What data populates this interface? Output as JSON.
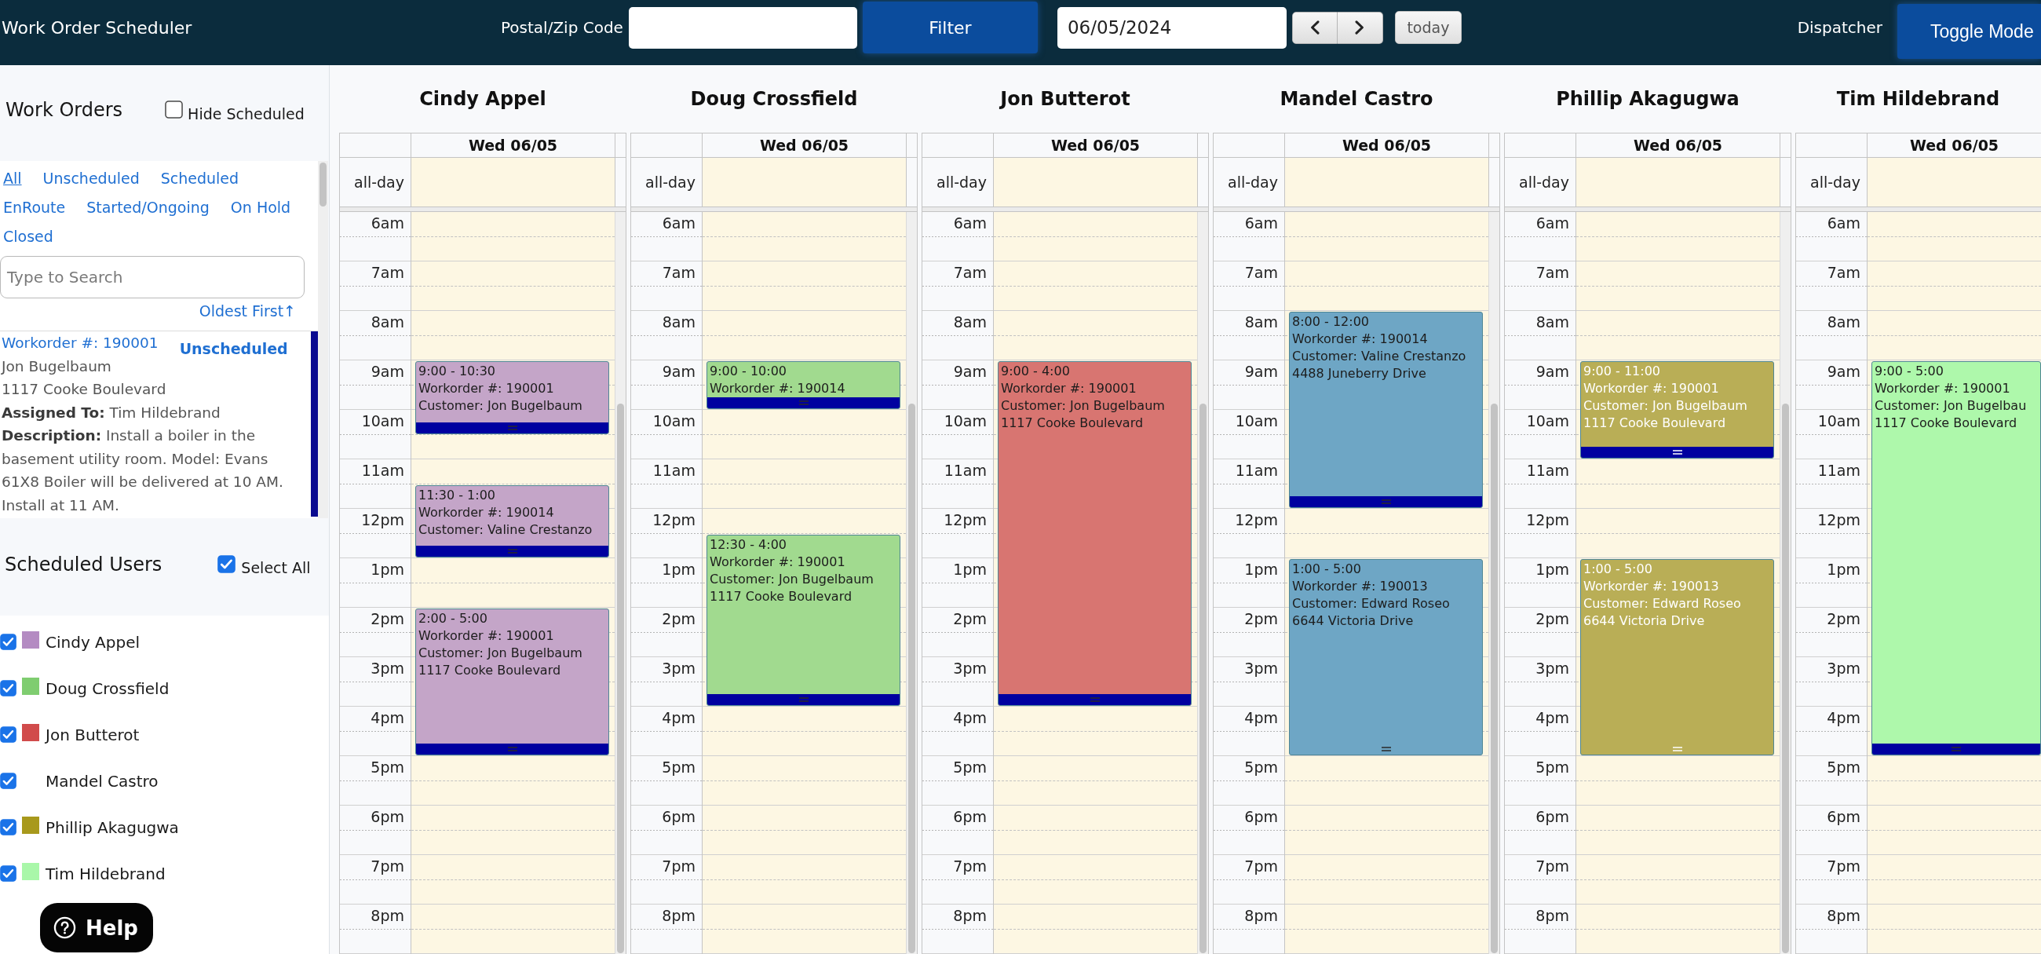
{
  "header": {
    "title": "Work Order Scheduler",
    "postal_label": "Postal/Zip Code",
    "filter_button": "Filter",
    "date": "06/05/2024",
    "today_button": "today",
    "mode_label": "Dispatcher",
    "toggle_button": "Toggle Mode"
  },
  "sidebar": {
    "work_orders": {
      "title": "Work Orders",
      "hide_scheduled": {
        "label": "Hide Scheduled",
        "checked": false
      },
      "filters": [
        {
          "label": "All",
          "selected": true
        },
        {
          "label": "Unscheduled",
          "selected": false
        },
        {
          "label": "Scheduled",
          "selected": false
        },
        {
          "label": "EnRoute",
          "selected": false
        },
        {
          "label": "Started/Ongoing",
          "selected": false
        },
        {
          "label": "On Hold",
          "selected": false
        },
        {
          "label": "Closed",
          "selected": false
        }
      ],
      "search": {
        "placeholder": "Type to Search"
      },
      "sort": "Oldest First↑",
      "items": [
        {
          "number": "Workorder #: 190001",
          "status": "Unscheduled",
          "customer": "Jon Bugelbaum",
          "address": "1117 Cooke Boulevard",
          "assigned": "**Assigned To:** Tim Hildebrand",
          "description": "**Description:** Install a boiler in the basement utility room. Model: Evans 61X8 Boiler will be delivered at 10 AM. Install at 11 AM."
        }
      ]
    },
    "scheduled_users": {
      "title": "Scheduled Users",
      "select_all": {
        "label": "Select All",
        "checked": true
      },
      "users": [
        {
          "name": "Cindy Appel",
          "checked": true,
          "color": "#b48bc2"
        },
        {
          "name": "Doug Crossfield",
          "checked": true,
          "color": "#7fcd70"
        },
        {
          "name": "Jon Butterot",
          "checked": true,
          "color": "#d14b4b"
        },
        {
          "name": "Mandel Castro",
          "checked": true
        },
        {
          "name": "Phillip Akagugwa",
          "checked": true,
          "color": "#a8991c"
        },
        {
          "name": "Tim Hildebrand",
          "checked": true,
          "color": "#a9f7a9"
        }
      ]
    },
    "help_button": "Help"
  },
  "calendar": {
    "columns": [
      {
        "name": "Cindy Appel",
        "day": "Wed 06/05",
        "all_day": "all-day",
        "hours": [
          "6am",
          "7am",
          "8am",
          "9am",
          "10am",
          "11am",
          "12pm",
          "1pm",
          "2pm",
          "3pm",
          "4pm",
          "5pm",
          "6pm",
          "7pm",
          "8pm"
        ],
        "color": "#c4a5c8",
        "light_text": false,
        "events": [
          {
            "time": "9:00 - 10:30",
            "lines": [
              "Workorder #: 190001",
              "Customer: Jon Bugelbaum"
            ],
            "handle_bar": true
          },
          {
            "time": "11:30 - 1:00",
            "lines": [
              "Workorder #: 190014",
              "Customer: Valine Crestanzo"
            ],
            "handle_bar": true
          },
          {
            "time": "2:00 - 5:00",
            "lines": [
              "Workorder #: 190001",
              "Customer: Jon Bugelbaum",
              "1117 Cooke Boulevard"
            ],
            "handle_bar": true
          }
        ]
      },
      {
        "name": "Doug Crossfield",
        "day": "Wed 06/05",
        "all_day": "all-day",
        "hours": [
          "6am",
          "7am",
          "8am",
          "9am",
          "10am",
          "11am",
          "12pm",
          "1pm",
          "2pm",
          "3pm",
          "4pm",
          "5pm",
          "6pm",
          "7pm",
          "8pm"
        ],
        "color": "#a1da8f",
        "light_text": false,
        "events": [
          {
            "time": "9:00 - 10:00",
            "lines": [
              "Workorder #: 190014"
            ],
            "handle_bar": true
          },
          {
            "time": "12:30 - 4:00",
            "lines": [
              "Workorder #: 190001",
              "Customer: Jon Bugelbaum",
              "1117 Cooke Boulevard"
            ],
            "handle_bar": true
          }
        ]
      },
      {
        "name": "Jon Butterot",
        "day": "Wed 06/05",
        "all_day": "all-day",
        "hours": [
          "6am",
          "7am",
          "8am",
          "9am",
          "10am",
          "11am",
          "12pm",
          "1pm",
          "2pm",
          "3pm",
          "4pm",
          "5pm",
          "6pm",
          "7pm",
          "8pm"
        ],
        "color": "#d87571",
        "light_text": false,
        "events": [
          {
            "time": "9:00 - 4:00",
            "lines": [
              "Workorder #: 190001",
              "Customer: Jon Bugelbaum",
              "1117 Cooke Boulevard"
            ],
            "handle_bar": true
          }
        ]
      },
      {
        "name": "Mandel Castro",
        "day": "Wed 06/05",
        "all_day": "all-day",
        "hours": [
          "6am",
          "7am",
          "8am",
          "9am",
          "10am",
          "11am",
          "12pm",
          "1pm",
          "2pm",
          "3pm",
          "4pm",
          "5pm",
          "6pm",
          "7pm",
          "8pm"
        ],
        "color": "#6ea6c5",
        "light_text": false,
        "events": [
          {
            "time": "8:00 - 12:00",
            "lines": [
              "Workorder #: 190014",
              "Customer: Valine Crestanzo",
              "4488 Juneberry Drive"
            ],
            "handle_bar": true
          },
          {
            "time": "1:00 - 5:00",
            "lines": [
              "Workorder #: 190013",
              "Customer: Edward Roseo",
              "6644 Victoria Drive"
            ],
            "handle_bar": false
          }
        ]
      },
      {
        "name": "Phillip Akagugwa",
        "day": "Wed 06/05",
        "all_day": "all-day",
        "hours": [
          "6am",
          "7am",
          "8am",
          "9am",
          "10am",
          "11am",
          "12pm",
          "1pm",
          "2pm",
          "3pm",
          "4pm",
          "5pm",
          "6pm",
          "7pm",
          "8pm"
        ],
        "color": "#b9ae56",
        "light_text": true,
        "events": [
          {
            "time": "9:00 - 11:00",
            "lines": [
              "Workorder #: 190001",
              "Customer: Jon Bugelbaum",
              "1117 Cooke Boulevard"
            ],
            "handle_bar": true
          },
          {
            "time": "1:00 - 5:00",
            "lines": [
              "Workorder #: 190013",
              "Customer: Edward Roseo",
              "6644 Victoria Drive"
            ],
            "handle_bar": false
          }
        ]
      },
      {
        "name": "Tim Hildebrand",
        "day": "Wed 06/05",
        "all_day": "all-day",
        "hours": [
          "6am",
          "7am",
          "8am",
          "9am",
          "10am",
          "11am",
          "12pm",
          "1pm",
          "2pm",
          "3pm",
          "4pm",
          "5pm",
          "6pm",
          "7pm",
          "8pm"
        ],
        "color": "#aef8ab",
        "light_text": false,
        "events": [
          {
            "time": "9:00 - 5:00",
            "lines": [
              "Workorder #: 190001",
              "Customer: Jon Bugelbau",
              "1117 Cooke Boulevard"
            ],
            "handle_bar": true
          }
        ]
      }
    ]
  }
}
